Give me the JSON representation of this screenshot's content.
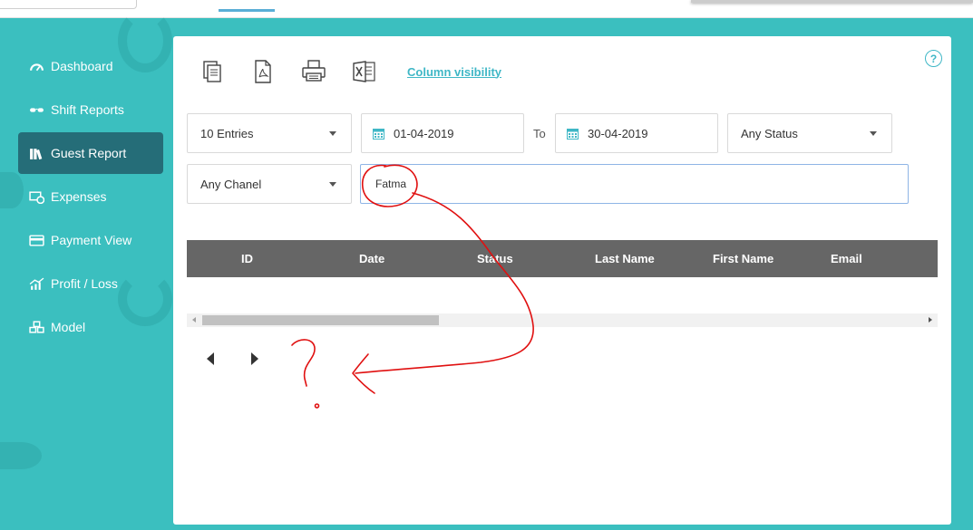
{
  "sidebar": {
    "items": [
      {
        "label": "Dashboard",
        "icon": "dashboard-gauge-icon"
      },
      {
        "label": "Shift Reports",
        "icon": "glasses-icon"
      },
      {
        "label": "Guest Report",
        "icon": "books-icon",
        "active": true
      },
      {
        "label": "Expenses",
        "icon": "money-icon"
      },
      {
        "label": "Payment View",
        "icon": "credit-card-icon"
      },
      {
        "label": "Profit / Loss",
        "icon": "chart-growth-icon"
      },
      {
        "label": "Model",
        "icon": "cubes-icon"
      }
    ]
  },
  "toolbar": {
    "icons": [
      "copy-icon",
      "pdf-icon",
      "print-icon",
      "excel-icon"
    ],
    "column_visibility": "Column visibility"
  },
  "filters": {
    "entries": "10 Entries",
    "date_from": "01-04-2019",
    "to_label": "To",
    "date_to": "30-04-2019",
    "status": "Any Status",
    "channel": "Any Chanel",
    "search_value": "Fatma"
  },
  "table": {
    "columns": [
      "ID",
      "Date",
      "Status",
      "Last Name",
      "First Name",
      "Email"
    ],
    "rows": []
  },
  "colors": {
    "background": "#3bbfbf",
    "active_nav": "#256d78",
    "accent": "#3fb7c6",
    "table_header": "#666666",
    "annotation": "#e01010"
  }
}
